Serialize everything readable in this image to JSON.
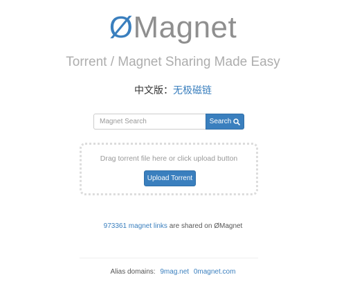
{
  "header": {
    "logo_symbol": "Ø",
    "logo_text": "Magnet",
    "tagline": "Torrent / Magnet Sharing Made Easy"
  },
  "lang": {
    "label": "中文版：",
    "link": "无极磁链"
  },
  "search": {
    "placeholder": "Magnet Search",
    "button_label": "Search",
    "button_icon": "search-icon"
  },
  "upload": {
    "instruction": "Drag torrent file here or click upload button",
    "button_label": "Upload Torrent"
  },
  "stats": {
    "count": "973361",
    "link_suffix": "magnet links",
    "text": "are shared on ØMagnet"
  },
  "footer": {
    "alias_label": "Alias domains:",
    "domains": [
      "9mag.net",
      "0magnet.com"
    ]
  },
  "colors": {
    "accent": "#3a7fbe",
    "logo_gray": "#8f8f8f",
    "tagline_gray": "#adadad"
  }
}
